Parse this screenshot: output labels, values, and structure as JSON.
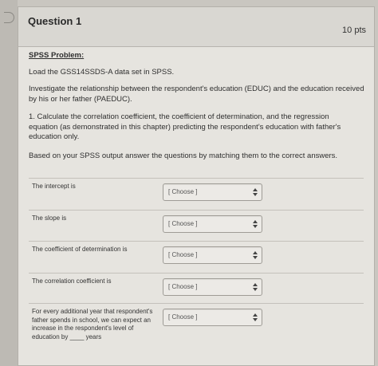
{
  "question": {
    "title": "Question 1",
    "points": "10 pts"
  },
  "content": {
    "heading": "SPSS Problem:",
    "load": "Load the GSS14SSDS-A data set in SPSS.",
    "investigate": "Investigate the relationship between the respondent's education (EDUC) and the education received by his or her father (PAEDUC).",
    "task": "1. Calculate the correlation coefficient, the coefficient of determination, and the regression equation (as demonstrated in this chapter) predicting the respondent's education with father's education only.",
    "instruction": "Based on your SPSS output answer the questions by matching them to the correct answers."
  },
  "matches": [
    {
      "label": "The intercept is",
      "value": "[ Choose ]"
    },
    {
      "label": "The slope is",
      "value": "[ Choose ]"
    },
    {
      "label": "The coefficient of determination is",
      "value": "[ Choose ]"
    },
    {
      "label": "The correlation coefficient is",
      "value": "[ Choose ]"
    },
    {
      "label": "For every additional year that respondent's father spends in school, we can expect an increase in the respondent's level of education by ____ years",
      "value": "[ Choose ]"
    }
  ]
}
